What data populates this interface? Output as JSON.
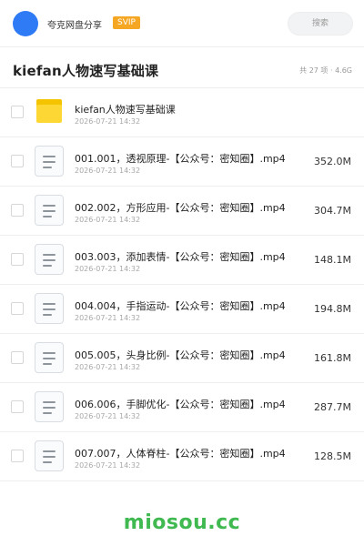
{
  "header": {
    "app_name": "夸克网盘分享",
    "badge": "SVIP",
    "search_placeholder": "搜索"
  },
  "folder": {
    "title": "kiefan人物速写基础课",
    "summary": "共 27 项 · 4.6G"
  },
  "items": [
    {
      "type": "folder",
      "name": "kiefan人物速写基础课",
      "date": "2026-07-21 14:32",
      "size": ""
    },
    {
      "type": "file",
      "name": "001.001，透视原理-【公众号：密知圈】.mp4",
      "date": "2026-07-21 14:32",
      "size": "352.0M"
    },
    {
      "type": "file",
      "name": "002.002，方形应用-【公众号：密知圈】.mp4",
      "date": "2026-07-21 14:32",
      "size": "304.7M"
    },
    {
      "type": "file",
      "name": "003.003，添加表情-【公众号：密知圈】.mp4",
      "date": "2026-07-21 14:32",
      "size": "148.1M"
    },
    {
      "type": "file",
      "name": "004.004，手指运动-【公众号：密知圈】.mp4",
      "date": "2026-07-21 14:32",
      "size": "194.8M"
    },
    {
      "type": "file",
      "name": "005.005，头身比例-【公众号：密知圈】.mp4",
      "date": "2026-07-21 14:32",
      "size": "161.8M"
    },
    {
      "type": "file",
      "name": "006.006，手脚优化-【公众号：密知圈】.mp4",
      "date": "2026-07-21 14:32",
      "size": "287.7M"
    },
    {
      "type": "file",
      "name": "007.007，人体脊柱-【公众号：密知圈】.mp4",
      "date": "2026-07-21 14:32",
      "size": "128.5M"
    }
  ],
  "footer": {
    "brand": "miosou.cc"
  },
  "colors": {
    "accent": "#2f7bf5",
    "badge": "#f5a623",
    "folder": "#fdd835",
    "brand": "#3fb950"
  }
}
